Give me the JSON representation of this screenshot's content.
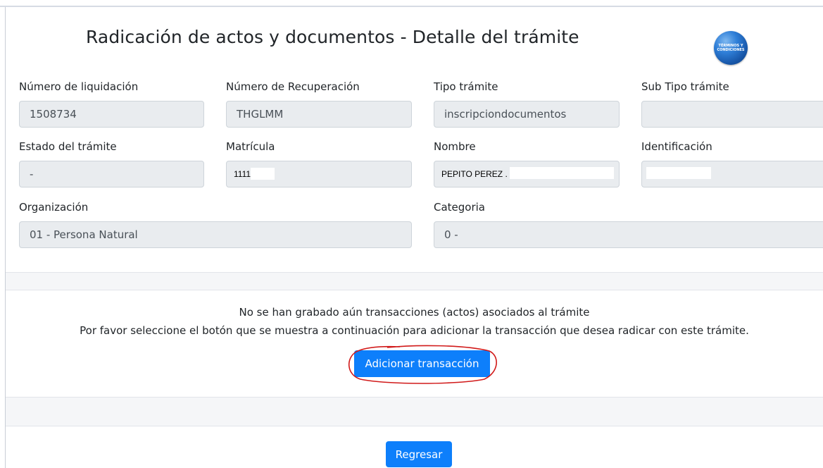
{
  "page": {
    "title": "Radicación de actos y documentos - Detalle del trámite",
    "badge_text": "TÉRMINOS Y CONDICIONES",
    "badge_icon": "terms-badge-icon"
  },
  "form": {
    "numero_liquidacion": {
      "label": "Número de liquidación",
      "value": "1508734"
    },
    "numero_recuperacion": {
      "label": "Número de Recuperación",
      "value": "THGLMM"
    },
    "tipo_tramite": {
      "label": "Tipo trámite",
      "value": "inscripciondocumentos"
    },
    "sub_tipo_tramite": {
      "label": "Sub Tipo trámite",
      "value": ""
    },
    "estado_tramite": {
      "label": "Estado del trámite",
      "value": "-"
    },
    "matricula": {
      "label": "Matrícula",
      "value": "1111"
    },
    "nombre": {
      "label": "Nombre",
      "value": "PEPITO PEREZ ."
    },
    "identificacion": {
      "label": "Identificación",
      "value": ""
    },
    "organizacion": {
      "label": "Organización",
      "value": "01 - Persona Natural"
    },
    "categoria": {
      "label": "Categoria",
      "value": "0 -"
    }
  },
  "transactions": {
    "empty_line1": "No se han grabado aún transacciones (actos) asociados al trámite",
    "empty_line2": "Por favor seleccione el botón que se muestra a continuación para adicionar la transacción que desea radicar con este trámite.",
    "add_button": "Adicionar transacción"
  },
  "footer": {
    "back_button": "Regresar"
  },
  "colors": {
    "primary": "#0d7ffb",
    "field_bg": "#e9ecef",
    "annotation": "#d11a1a"
  }
}
